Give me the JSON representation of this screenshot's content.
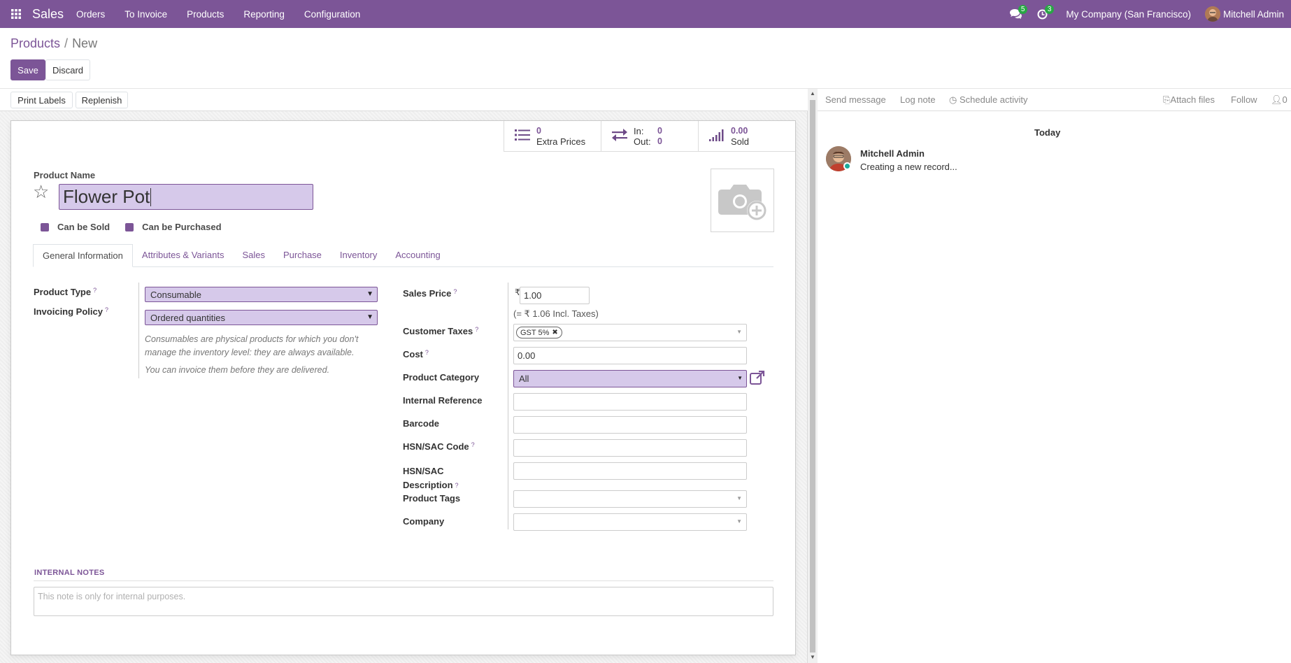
{
  "navbar": {
    "app_name": "Sales",
    "menu": [
      "Orders",
      "To Invoice",
      "Products",
      "Reporting",
      "Configuration"
    ],
    "messages_count": "5",
    "activities_count": "3",
    "company": "My Company (San Francisco)",
    "user": "Mitchell Admin",
    "bg_color": "#7c5597"
  },
  "breadcrumb": {
    "parent": "Products",
    "separator": "/",
    "current": "New"
  },
  "control": {
    "save": "Save",
    "discard": "Discard"
  },
  "statusbar": {
    "print_labels": "Print Labels",
    "replenish": "Replenish"
  },
  "smart_buttons": {
    "extra_prices": {
      "value": "0",
      "label": "Extra Prices"
    },
    "moves": {
      "in_label": "In:",
      "in_value": "0",
      "out_label": "Out:",
      "out_value": "0"
    },
    "sold": {
      "value": "0.00",
      "label": "Sold"
    }
  },
  "product": {
    "name_label": "Product Name",
    "name": "Flower Pot",
    "can_be_sold": "Can be Sold",
    "can_be_purchased": "Can be Purchased"
  },
  "tabs": [
    "General Information",
    "Attributes & Variants",
    "Sales",
    "Purchase",
    "Inventory",
    "Accounting"
  ],
  "general": {
    "product_type_label": "Product Type",
    "product_type": "Consumable",
    "invoicing_policy_label": "Invoicing Policy",
    "invoicing_policy": "Ordered quantities",
    "note_1": "Consumables are physical products for which you don't manage the inventory level: they are always available.",
    "note_2": "You can invoice them before they are delivered.",
    "sales_price_label": "Sales Price",
    "currency": "₹",
    "sales_price": "1.00",
    "incl_taxes": "(= ₹ 1.06 Incl. Taxes)",
    "customer_taxes_label": "Customer Taxes",
    "tax_tag": "GST 5%",
    "cost_label": "Cost",
    "cost": "0.00",
    "category_label": "Product Category",
    "category": "All",
    "internal_ref_label": "Internal Reference",
    "barcode_label": "Barcode",
    "hsn_code_label": "HSN/SAC Code",
    "hsn_desc_label_1": "HSN/SAC",
    "hsn_desc_label_2": "Description",
    "tags_label": "Product Tags",
    "company_label": "Company",
    "help": "?"
  },
  "notes": {
    "title": "INTERNAL NOTES",
    "placeholder": "This note is only for internal purposes."
  },
  "chatter": {
    "send_message": "Send message",
    "log_note": "Log note",
    "schedule_activity": "Schedule activity",
    "attach_files": "Attach files",
    "follow": "Follow",
    "followers": "0",
    "today": "Today",
    "author": "Mitchell Admin",
    "body": "Creating a new record..."
  }
}
